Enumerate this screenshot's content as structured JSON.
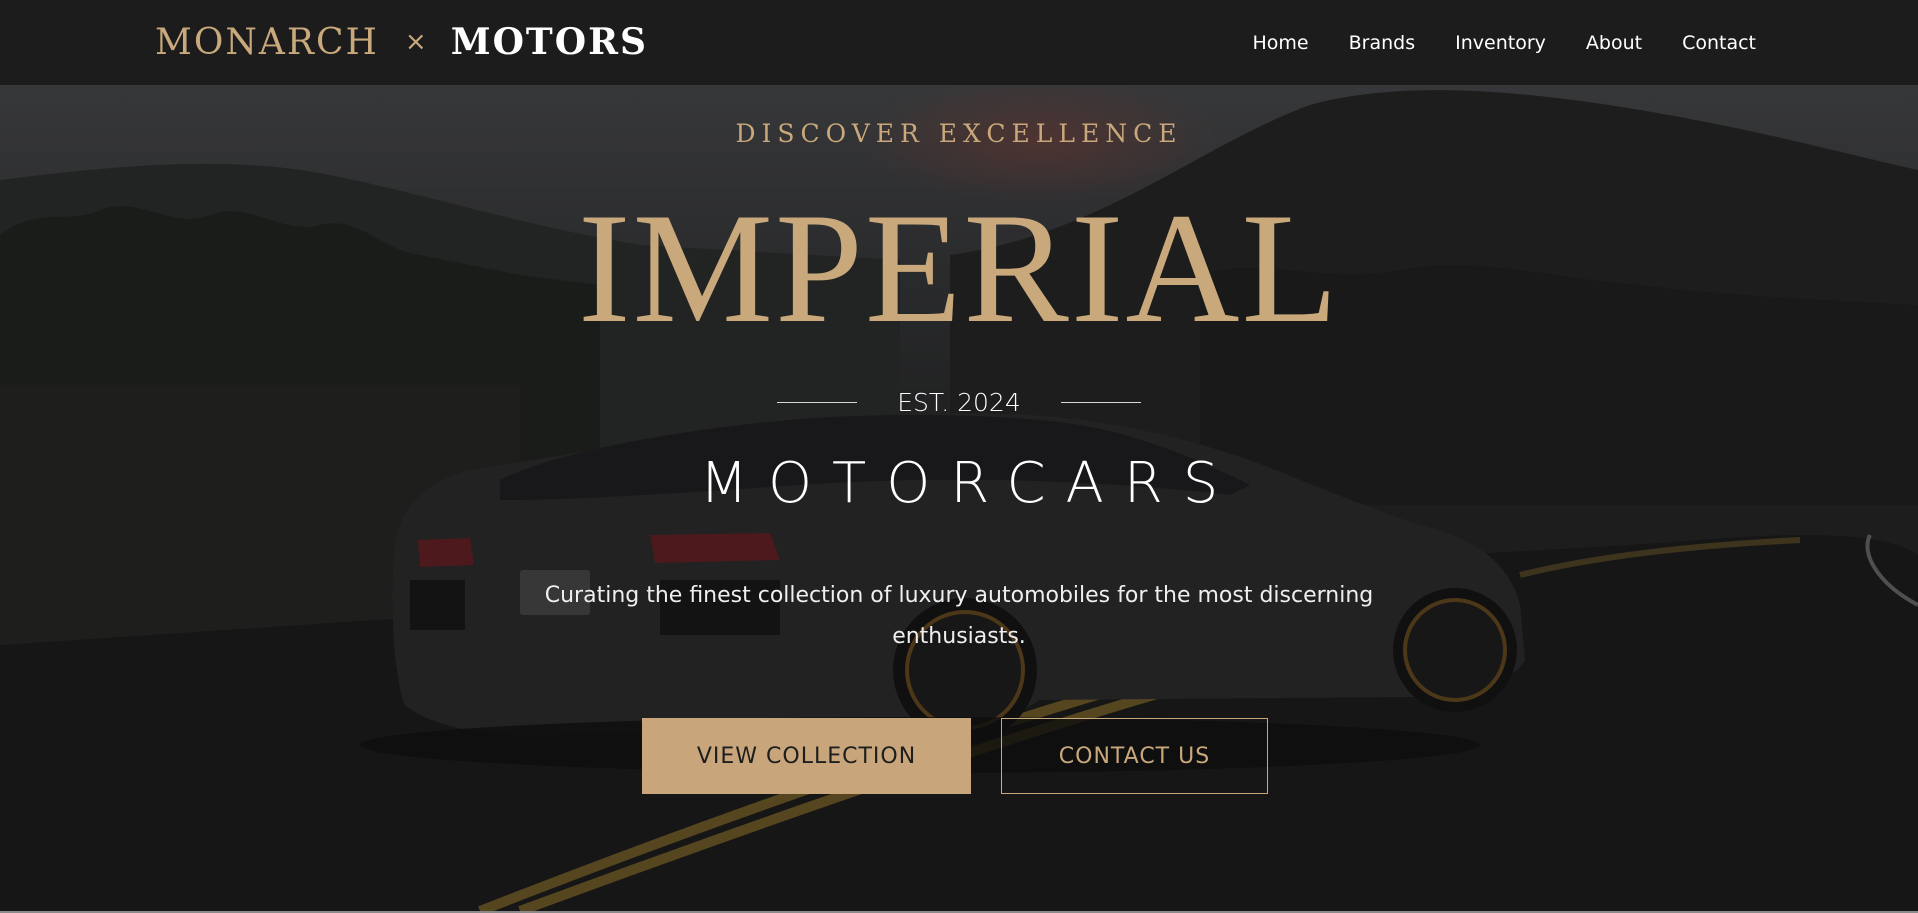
{
  "brand": {
    "primary": "MONARCH",
    "separator": "×",
    "secondary": "MOTORS"
  },
  "nav": {
    "items": [
      {
        "label": "Home"
      },
      {
        "label": "Brands"
      },
      {
        "label": "Inventory"
      },
      {
        "label": "About"
      },
      {
        "label": "Contact"
      }
    ]
  },
  "hero": {
    "eyebrow": "DISCOVER EXCELLENCE",
    "title": "IMPERIAL",
    "established": "EST. 2024",
    "subtitle": "MOTORCARS",
    "tagline": "Curating the finest collection of luxury automobiles for the most discerning enthusiasts.",
    "background_image": "dark sports car on road at dusk",
    "buttons": {
      "primary": "VIEW COLLECTION",
      "secondary": "CONTACT US"
    }
  },
  "colors": {
    "accent_gold": "#c9a87b",
    "button_gold": "#c8a57b",
    "navbar_bg": "#1c1c1c",
    "text_white": "#ffffff"
  }
}
